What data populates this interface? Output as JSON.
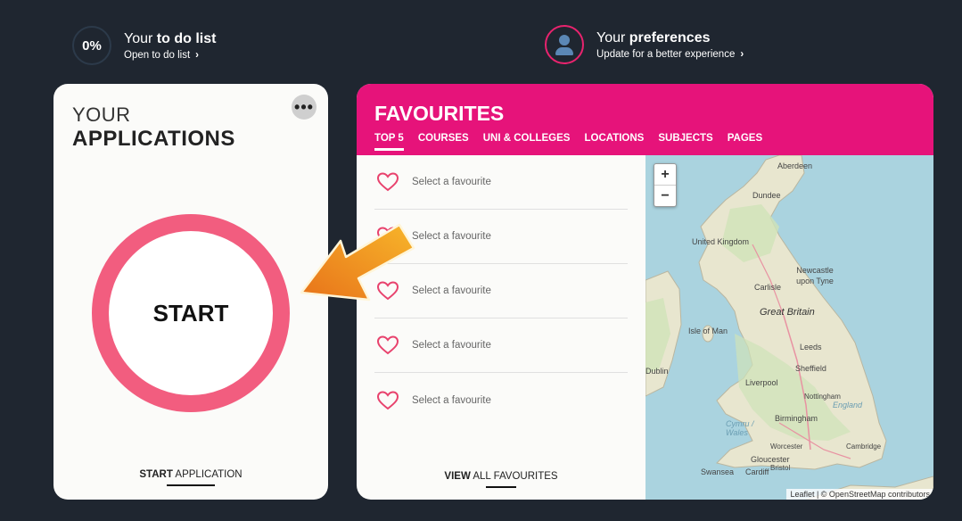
{
  "todo": {
    "badge": "0%",
    "title_prefix": "Your ",
    "title_bold": "to do list",
    "link": "Open to do list"
  },
  "preferences": {
    "title_prefix": "Your ",
    "title_bold": "preferences",
    "link": "Update for a better experience"
  },
  "applications": {
    "title_line1": "YOUR",
    "title_line2": "APPLICATIONS",
    "more": "•••",
    "start": "START",
    "start_app_bold": "START",
    "start_app_rest": " APPLICATION"
  },
  "favourites": {
    "title": "FAVOURITES",
    "tabs": [
      "TOP 5",
      "COURSES",
      "UNI & COLLEGES",
      "LOCATIONS",
      "SUBJECTS",
      "PAGES"
    ],
    "items": [
      "Select a favourite",
      "Select a favourite",
      "Select a favourite",
      "Select a favourite",
      "Select a favourite"
    ],
    "view_all_bold": "VIEW",
    "view_all_rest": " ALL FAVOURITES"
  },
  "map": {
    "zoom_in": "+",
    "zoom_out": "−",
    "labels": [
      "Aberdeen",
      "Dundee",
      "United Kingdom",
      "Newcastle upon Tyne",
      "Carlisle",
      "Great Britain",
      "Isle of Man",
      "Leeds",
      "Dublin",
      "Sheffield",
      "Liverpool",
      "Nottingham",
      "England",
      "Birmingham",
      "Cymru / Wales",
      "Worcester",
      "Cambridge",
      "Gloucester",
      "Swansea",
      "Cardiff",
      "Bristol"
    ],
    "attribution": "Leaflet | © OpenStreetMap contributors"
  },
  "colors": {
    "background": "#1f2630",
    "accent": "#e6137a",
    "ring": "#f25d7f",
    "sea": "#aad3df"
  }
}
